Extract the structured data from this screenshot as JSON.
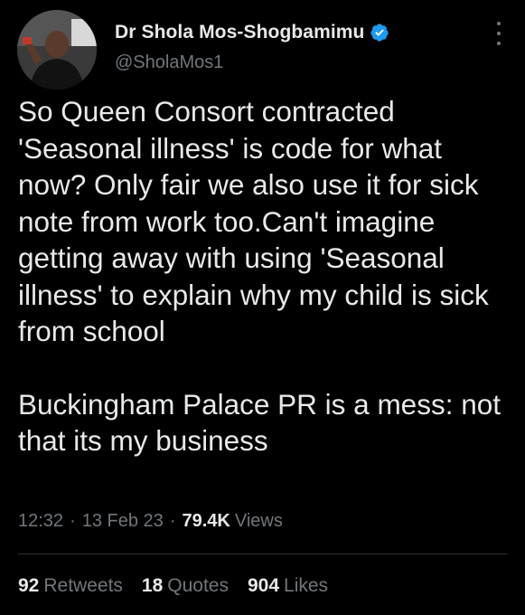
{
  "author": {
    "display_name": "Dr Shola Mos-Shogbamimu",
    "handle": "@SholaMos1",
    "verified_icon": "verified-badge-icon",
    "accent_color": "#1d9bf0"
  },
  "tweet": {
    "paragraph_1": "So Queen Consort contracted 'Seasonal illness' is code for what now? Only fair we also use it for sick note from work too.Can't imagine getting away with using 'Seasonal illness' to explain why my child is sick from school",
    "paragraph_2": "Buckingham Palace PR is a mess: not that its my business"
  },
  "meta": {
    "time": "12:32",
    "separator": "·",
    "date": "13 Feb 23",
    "views_count": "79.4K",
    "views_label": "Views"
  },
  "stats": {
    "retweets_count": "92",
    "retweets_label": "Retweets",
    "quotes_count": "18",
    "quotes_label": "Quotes",
    "likes_count": "904",
    "likes_label": "Likes"
  },
  "colors": {
    "background": "#000000",
    "primary_text": "#e7e9ea",
    "secondary_text": "#71767b",
    "divider": "#2f3336"
  }
}
